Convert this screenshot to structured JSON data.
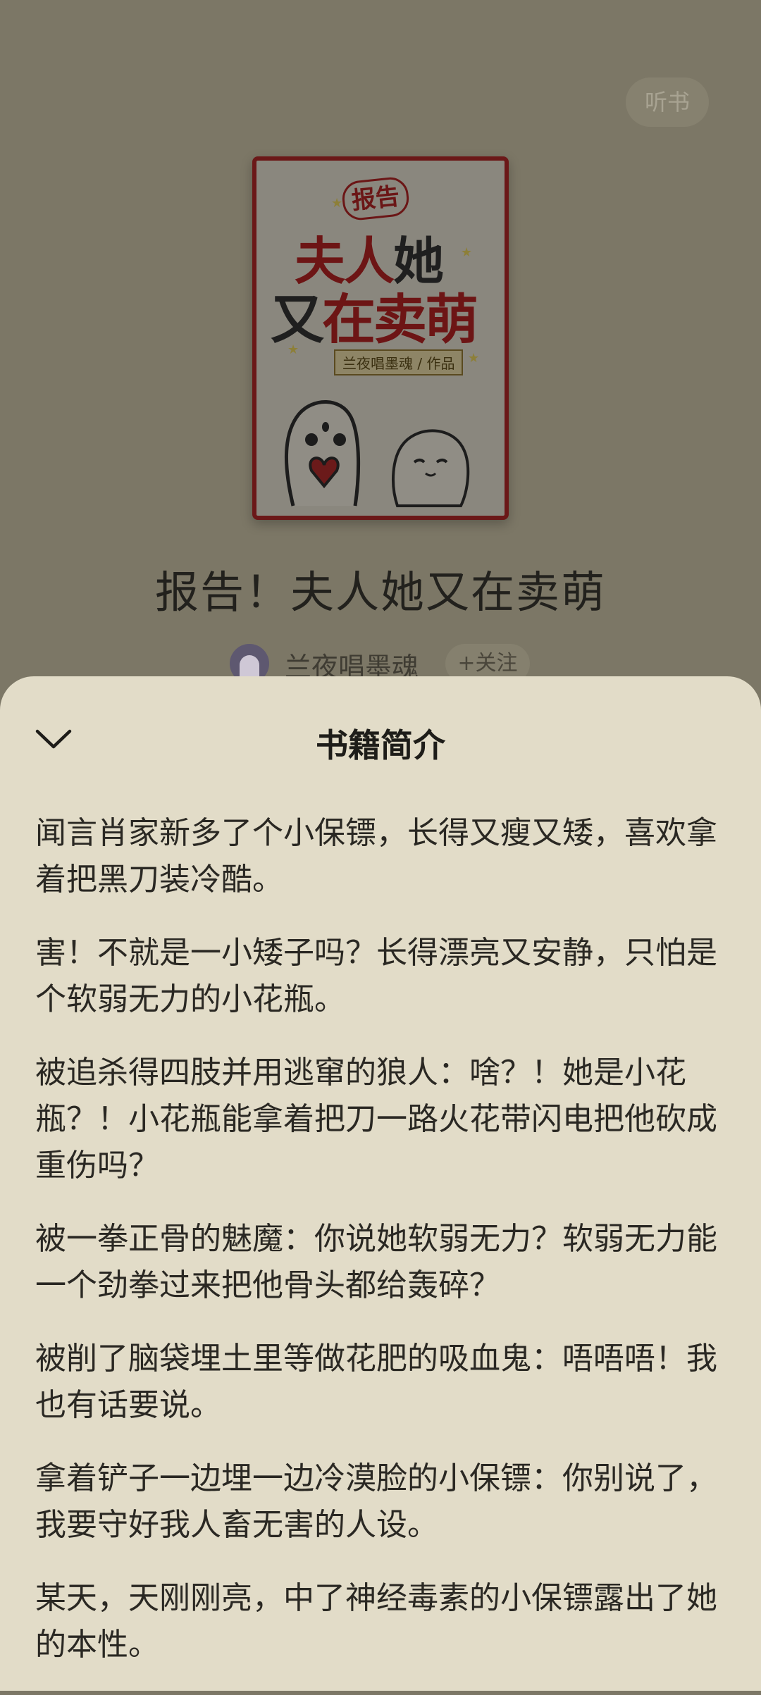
{
  "header": {
    "listen_label": "听书"
  },
  "cover": {
    "badge": "报告",
    "line1a": "夫人",
    "line1b": "她",
    "line2a": "又",
    "line2b": "在",
    "line2c": "卖萌",
    "author_tag": "兰夜唱墨魂 / 作品"
  },
  "book": {
    "title": "报告！夫人她又在卖萌"
  },
  "author": {
    "name": "兰夜唱墨魂",
    "follow_label": "+关注"
  },
  "sheet": {
    "title": "书籍简介",
    "paragraphs": [
      "闻言肖家新多了个小保镖，长得又瘦又矮，喜欢拿着把黑刀装冷酷。",
      "害！不就是一小矮子吗？长得漂亮又安静，只怕是个软弱无力的小花瓶。",
      "被追杀得四肢并用逃窜的狼人：啥？！她是小花瓶？！小花瓶能拿着把刀一路火花带闪电把他砍成重伤吗？",
      "被一拳正骨的魅魔：你说她软弱无力？软弱无力能一个劲拳过来把他骨头都给轰碎？",
      "被削了脑袋埋土里等做花肥的吸血鬼：唔唔唔！我也有话要说。",
      "拿着铲子一边埋一边冷漠脸的小保镖：你别说了，我要守好我人畜无害的人设。",
      "某天，天刚刚亮，中了神经毒素的小保镖露出了她的本性。"
    ]
  },
  "colors": {
    "sheet_bg": "#e2dcc8",
    "overlay_bg": "#7c7766",
    "cover_red": "#6d1515"
  }
}
